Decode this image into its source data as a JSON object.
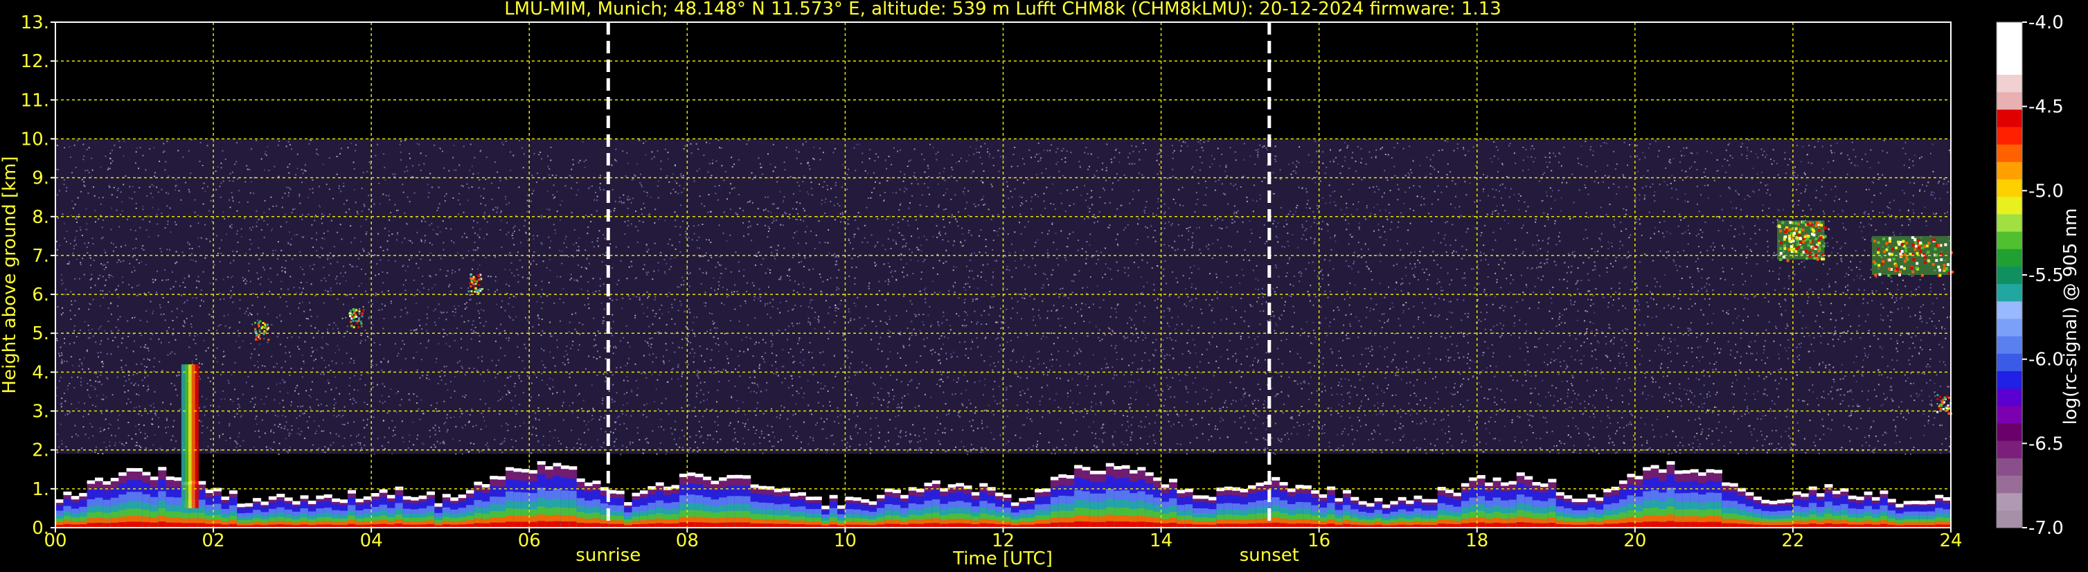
{
  "chart_data": {
    "type": "heatmap",
    "title": "LMU-MIM, Munich; 48.148° N 11.573° E, altitude: 539 m    Lufft CHM8k (CHM8kLMU): 20-12-2024    firmware: 1.13",
    "xlabel": "Time [UTC]",
    "ylabel": "Height above ground [km]",
    "xlim": [
      0,
      24
    ],
    "ylim": [
      0,
      13
    ],
    "x_ticks": [
      "00",
      "02",
      "04",
      "06",
      "08",
      "10",
      "12",
      "14",
      "16",
      "18",
      "20",
      "22",
      "24"
    ],
    "y_ticks": [
      "0.",
      "1.",
      "2.",
      "3.",
      "4.",
      "5.",
      "6.",
      "7.",
      "8.",
      "9.",
      "10.",
      "11.",
      "12.",
      "13."
    ],
    "grid": true,
    "measurement_top_km": 10,
    "markers": [
      {
        "label": "sunrise",
        "x": 7.0
      },
      {
        "label": "sunset",
        "x": 15.37
      }
    ],
    "colorbar": {
      "label": "log(rc-signal) @ 905 nm",
      "range": [
        -7.0,
        -4.0
      ],
      "ticks": [
        "-4.0",
        "-4.5",
        "-5.0",
        "-5.5",
        "-6.0",
        "-6.5",
        "-7.0"
      ],
      "colors": [
        "#a690a8",
        "#b09ab3",
        "#986d98",
        "#8a4f8a",
        "#7c1f7c",
        "#6a006a",
        "#7a00b0",
        "#5a00d0",
        "#2020e6",
        "#3a5ae8",
        "#5a80f0",
        "#7aa0f8",
        "#98b8ff",
        "#20a8a0",
        "#109060",
        "#20a030",
        "#50c030",
        "#a0e040",
        "#e8f020",
        "#ffd000",
        "#ffa000",
        "#ff6000",
        "#ff2000",
        "#e00000",
        "#e8b0b0",
        "#f0d0d0",
        "#ffffff",
        "#ffffff",
        "#ffffff"
      ]
    },
    "features": [
      {
        "name": "boundary layer aerosol",
        "x_range": [
          0,
          24
        ],
        "height_km": [
          0,
          1.9
        ]
      },
      {
        "name": "cloud patch",
        "time": 5.3,
        "height_km": 6.3
      },
      {
        "name": "cloud patch",
        "time": 2.6,
        "height_km": 5.1
      },
      {
        "name": "cloud patch",
        "time": 3.8,
        "height_km": 5.4
      },
      {
        "name": "cloud layer",
        "time_range": [
          21.8,
          22.4
        ],
        "height_km": [
          6.9,
          7.9
        ]
      },
      {
        "name": "cloud layer",
        "time_range": [
          23.0,
          24.0
        ],
        "height_km": [
          6.5,
          7.5
        ]
      },
      {
        "name": "cloud patch",
        "time": 23.9,
        "height_km": 3.2
      },
      {
        "name": "precipitation streak",
        "time": 1.7,
        "height_km": [
          0.5,
          4.2
        ]
      }
    ]
  }
}
